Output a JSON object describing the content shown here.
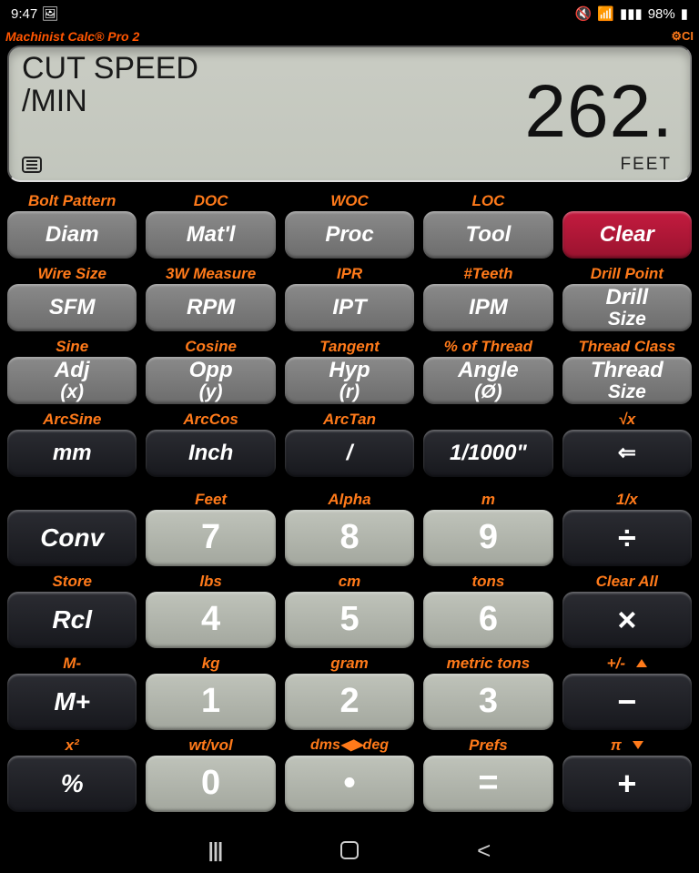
{
  "status": {
    "time": "9:47",
    "battery": "98%"
  },
  "brand": {
    "title": "Machinist Calc® Pro 2",
    "right": "⚙CI"
  },
  "display": {
    "label1": "CUT SPEED",
    "label2": "/MIN",
    "value": "262.",
    "suffix": "FEET"
  },
  "rows": [
    [
      {
        "u": "Bolt Pattern",
        "l": "Diam",
        "cls": "k-gray"
      },
      {
        "u": "DOC",
        "l": "Mat'l",
        "cls": "k-gray"
      },
      {
        "u": "WOC",
        "l": "Proc",
        "cls": "k-gray"
      },
      {
        "u": "LOC",
        "l": "Tool",
        "cls": "k-gray"
      },
      {
        "u": "",
        "l": "Clear",
        "cls": "k-red"
      }
    ],
    [
      {
        "u": "Wire Size",
        "l": "SFM",
        "cls": "k-gray"
      },
      {
        "u": "3W Measure",
        "l": "RPM",
        "cls": "k-gray"
      },
      {
        "u": "IPR",
        "l": "IPT",
        "cls": "k-gray"
      },
      {
        "u": "#Teeth",
        "l": "IPM",
        "cls": "k-gray"
      },
      {
        "u": "Drill Point",
        "l": "Drill",
        "l2": "Size",
        "cls": "k-gray"
      }
    ],
    [
      {
        "u": "Sine",
        "l": "Adj",
        "l2": "(x)",
        "cls": "k-gray"
      },
      {
        "u": "Cosine",
        "l": "Opp",
        "l2": "(y)",
        "cls": "k-gray"
      },
      {
        "u": "Tangent",
        "l": "Hyp",
        "l2": "(r)",
        "cls": "k-gray"
      },
      {
        "u": "% of Thread",
        "l": "Angle",
        "l2": "(Ø)",
        "cls": "k-gray"
      },
      {
        "u": "Thread Class",
        "l": "Thread",
        "l2": "Size",
        "cls": "k-gray"
      }
    ],
    [
      {
        "u": "ArcSine",
        "l": "mm",
        "cls": "k-blackf"
      },
      {
        "u": "ArcCos",
        "l": "Inch",
        "cls": "k-blackf"
      },
      {
        "u": "ArcTan",
        "l": "/",
        "cls": "k-blackf"
      },
      {
        "u": "",
        "l": "1/1000\"",
        "cls": "k-blackf"
      },
      {
        "u": "√x",
        "l": "⇐",
        "cls": "k-black"
      }
    ]
  ],
  "numrows": [
    [
      {
        "u": "",
        "l": "Conv",
        "cls": "k-orange k-func"
      },
      {
        "u": "Feet",
        "l": "7",
        "cls": "k-num"
      },
      {
        "u": "Alpha",
        "l": "8",
        "cls": "k-num"
      },
      {
        "u": "m",
        "l": "9",
        "cls": "k-num"
      },
      {
        "u": "1/x",
        "l": "÷",
        "cls": "k-op"
      }
    ],
    [
      {
        "u": "Store",
        "l": "Rcl",
        "cls": "k-func"
      },
      {
        "u": "lbs",
        "l": "4",
        "cls": "k-num"
      },
      {
        "u": "cm",
        "l": "5",
        "cls": "k-num"
      },
      {
        "u": "tons",
        "l": "6",
        "cls": "k-num"
      },
      {
        "u": "Clear All",
        "l": "×",
        "cls": "k-op"
      }
    ],
    [
      {
        "u": "M-",
        "l": "M+",
        "cls": "k-func"
      },
      {
        "u": "kg",
        "l": "1",
        "cls": "k-num"
      },
      {
        "u": "gram",
        "l": "2",
        "cls": "k-num"
      },
      {
        "u": "metric tons",
        "l": "3",
        "cls": "k-num"
      },
      {
        "u": "+/-",
        "tri": "up",
        "l": "−",
        "cls": "k-op"
      }
    ],
    [
      {
        "u": "x²",
        "l": "%",
        "cls": "k-func"
      },
      {
        "u": "wt/vol",
        "l": "0",
        "cls": "k-num"
      },
      {
        "u": "dms◀▶deg",
        "l": "•",
        "cls": "k-num"
      },
      {
        "u": "Prefs",
        "l": "=",
        "cls": "k-num"
      },
      {
        "u": "π",
        "tri": "down",
        "l": "+",
        "cls": "k-op"
      }
    ]
  ]
}
